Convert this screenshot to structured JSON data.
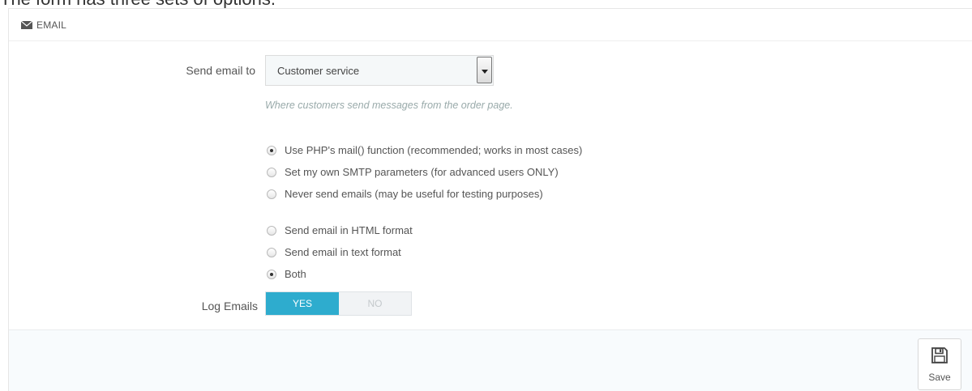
{
  "caption": "The form has three sets of options.",
  "panel": {
    "heading": "EMAIL",
    "heading_icon": "envelope-icon"
  },
  "send_email": {
    "label": "Send email to",
    "selected": "Customer service",
    "hint": "Where customers send messages from the order page."
  },
  "mail_method": {
    "options": [
      {
        "label": "Use PHP's mail() function (recommended; works in most cases)",
        "checked": true
      },
      {
        "label": "Set my own SMTP parameters (for advanced users ONLY)",
        "checked": false
      },
      {
        "label": "Never send emails (may be useful for testing purposes)",
        "checked": false
      }
    ]
  },
  "mail_format": {
    "options": [
      {
        "label": "Send email in HTML format",
        "checked": false
      },
      {
        "label": "Send email in text format",
        "checked": false
      },
      {
        "label": "Both",
        "checked": true
      }
    ]
  },
  "log_emails": {
    "label": "Log Emails",
    "yes": "YES",
    "no": "NO",
    "value": "YES",
    "active_color": "#2eacce"
  },
  "footer": {
    "save_label": "Save",
    "save_icon": "floppy-disk-icon"
  }
}
